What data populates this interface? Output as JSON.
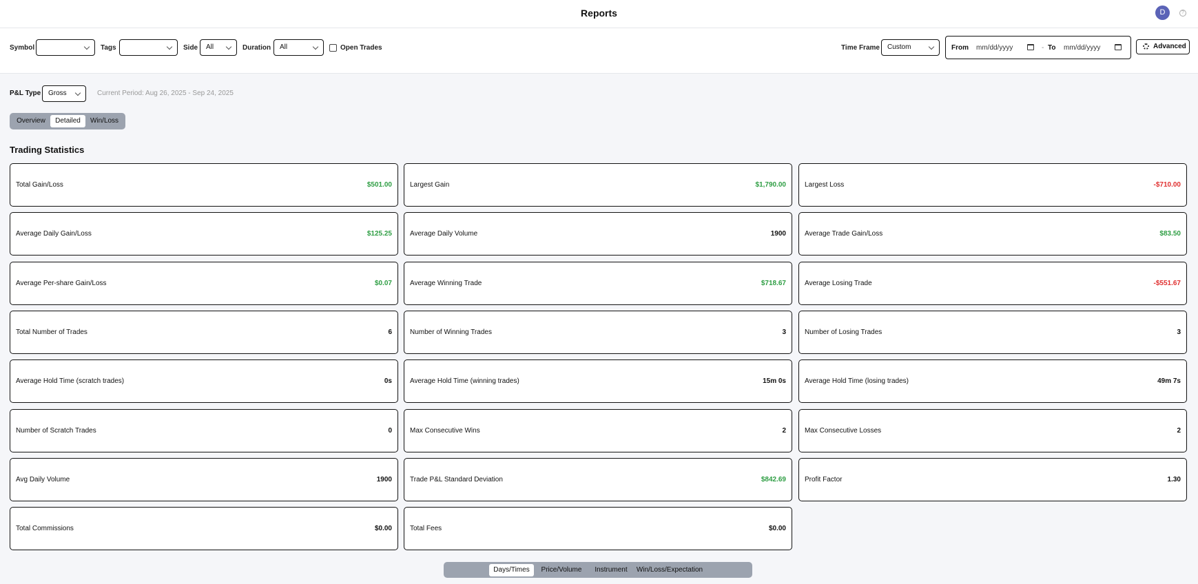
{
  "header": {
    "title": "Reports",
    "avatar_initial": "D",
    "help_glyph": "?"
  },
  "filters": {
    "symbol_label": "Symbol",
    "symbol_value": "",
    "tags_label": "Tags",
    "tags_value": "",
    "side_label": "Side",
    "side_value": "All",
    "duration_label": "Duration",
    "duration_value": "All",
    "open_trades_label": "Open Trades",
    "timeframe_label": "Time Frame",
    "timeframe_value": "Custom",
    "from_label": "From",
    "from_placeholder": "mm/dd/yyyy",
    "to_label": "To",
    "to_placeholder": "mm/dd/yyyy",
    "range_separator": "-",
    "advanced_label": "Advanced"
  },
  "pnl": {
    "label": "P&L Type",
    "value": "Gross",
    "period": "Current Period: Aug 26, 2025 - Sep 24, 2025"
  },
  "view_tabs": [
    {
      "label": "Overview",
      "active": false
    },
    {
      "label": "Detailed",
      "active": true
    },
    {
      "label": "Win/Loss",
      "active": false
    }
  ],
  "section_title": "Trading Statistics",
  "stats": [
    {
      "label": "Total Gain/Loss",
      "value": "$501.00",
      "tone": "pos"
    },
    {
      "label": "Largest Gain",
      "value": "$1,790.00",
      "tone": "pos"
    },
    {
      "label": "Largest Loss",
      "value": "-$710.00",
      "tone": "neg"
    },
    {
      "label": "Average Daily Gain/Loss",
      "value": "$125.25",
      "tone": "pos"
    },
    {
      "label": "Average Daily Volume",
      "value": "1900",
      "tone": "neutral"
    },
    {
      "label": "Average Trade Gain/Loss",
      "value": "$83.50",
      "tone": "pos"
    },
    {
      "label": "Average Per-share Gain/Loss",
      "value": "$0.07",
      "tone": "pos"
    },
    {
      "label": "Average Winning Trade",
      "value": "$718.67",
      "tone": "pos"
    },
    {
      "label": "Average Losing Trade",
      "value": "-$551.67",
      "tone": "neg"
    },
    {
      "label": "Total Number of Trades",
      "value": "6",
      "tone": "neutral"
    },
    {
      "label": "Number of Winning Trades",
      "value": "3",
      "tone": "neutral"
    },
    {
      "label": "Number of Losing Trades",
      "value": "3",
      "tone": "neutral"
    },
    {
      "label": "Average Hold Time (scratch trades)",
      "value": "0s",
      "tone": "neutral"
    },
    {
      "label": "Average Hold Time (winning trades)",
      "value": "15m 0s",
      "tone": "neutral"
    },
    {
      "label": "Average Hold Time (losing trades)",
      "value": "49m 7s",
      "tone": "neutral"
    },
    {
      "label": "Number of Scratch Trades",
      "value": "0",
      "tone": "neutral"
    },
    {
      "label": "Max Consecutive Wins",
      "value": "2",
      "tone": "neutral"
    },
    {
      "label": "Max Consecutive Losses",
      "value": "2",
      "tone": "neutral"
    },
    {
      "label": "Avg Daily Volume",
      "value": "1900",
      "tone": "neutral"
    },
    {
      "label": "Trade P&L Standard Deviation",
      "value": "$842.69",
      "tone": "pos"
    },
    {
      "label": "Profit Factor",
      "value": "1.30",
      "tone": "neutral"
    },
    {
      "label": "Total Commissions",
      "value": "$0.00",
      "tone": "neutral"
    },
    {
      "label": "Total Fees",
      "value": "$0.00",
      "tone": "neutral"
    }
  ],
  "bottom_tabs": [
    {
      "label": "Days/Times",
      "active": true
    },
    {
      "label": "Price/Volume",
      "active": false
    },
    {
      "label": "Instrument",
      "active": false
    },
    {
      "label": "Win/Loss/Expectation",
      "active": false
    }
  ],
  "colors": {
    "positive": "#2f9e44",
    "negative": "#e03131",
    "avatar": "#5b63b7",
    "segment_bg": "#9ca3af"
  }
}
